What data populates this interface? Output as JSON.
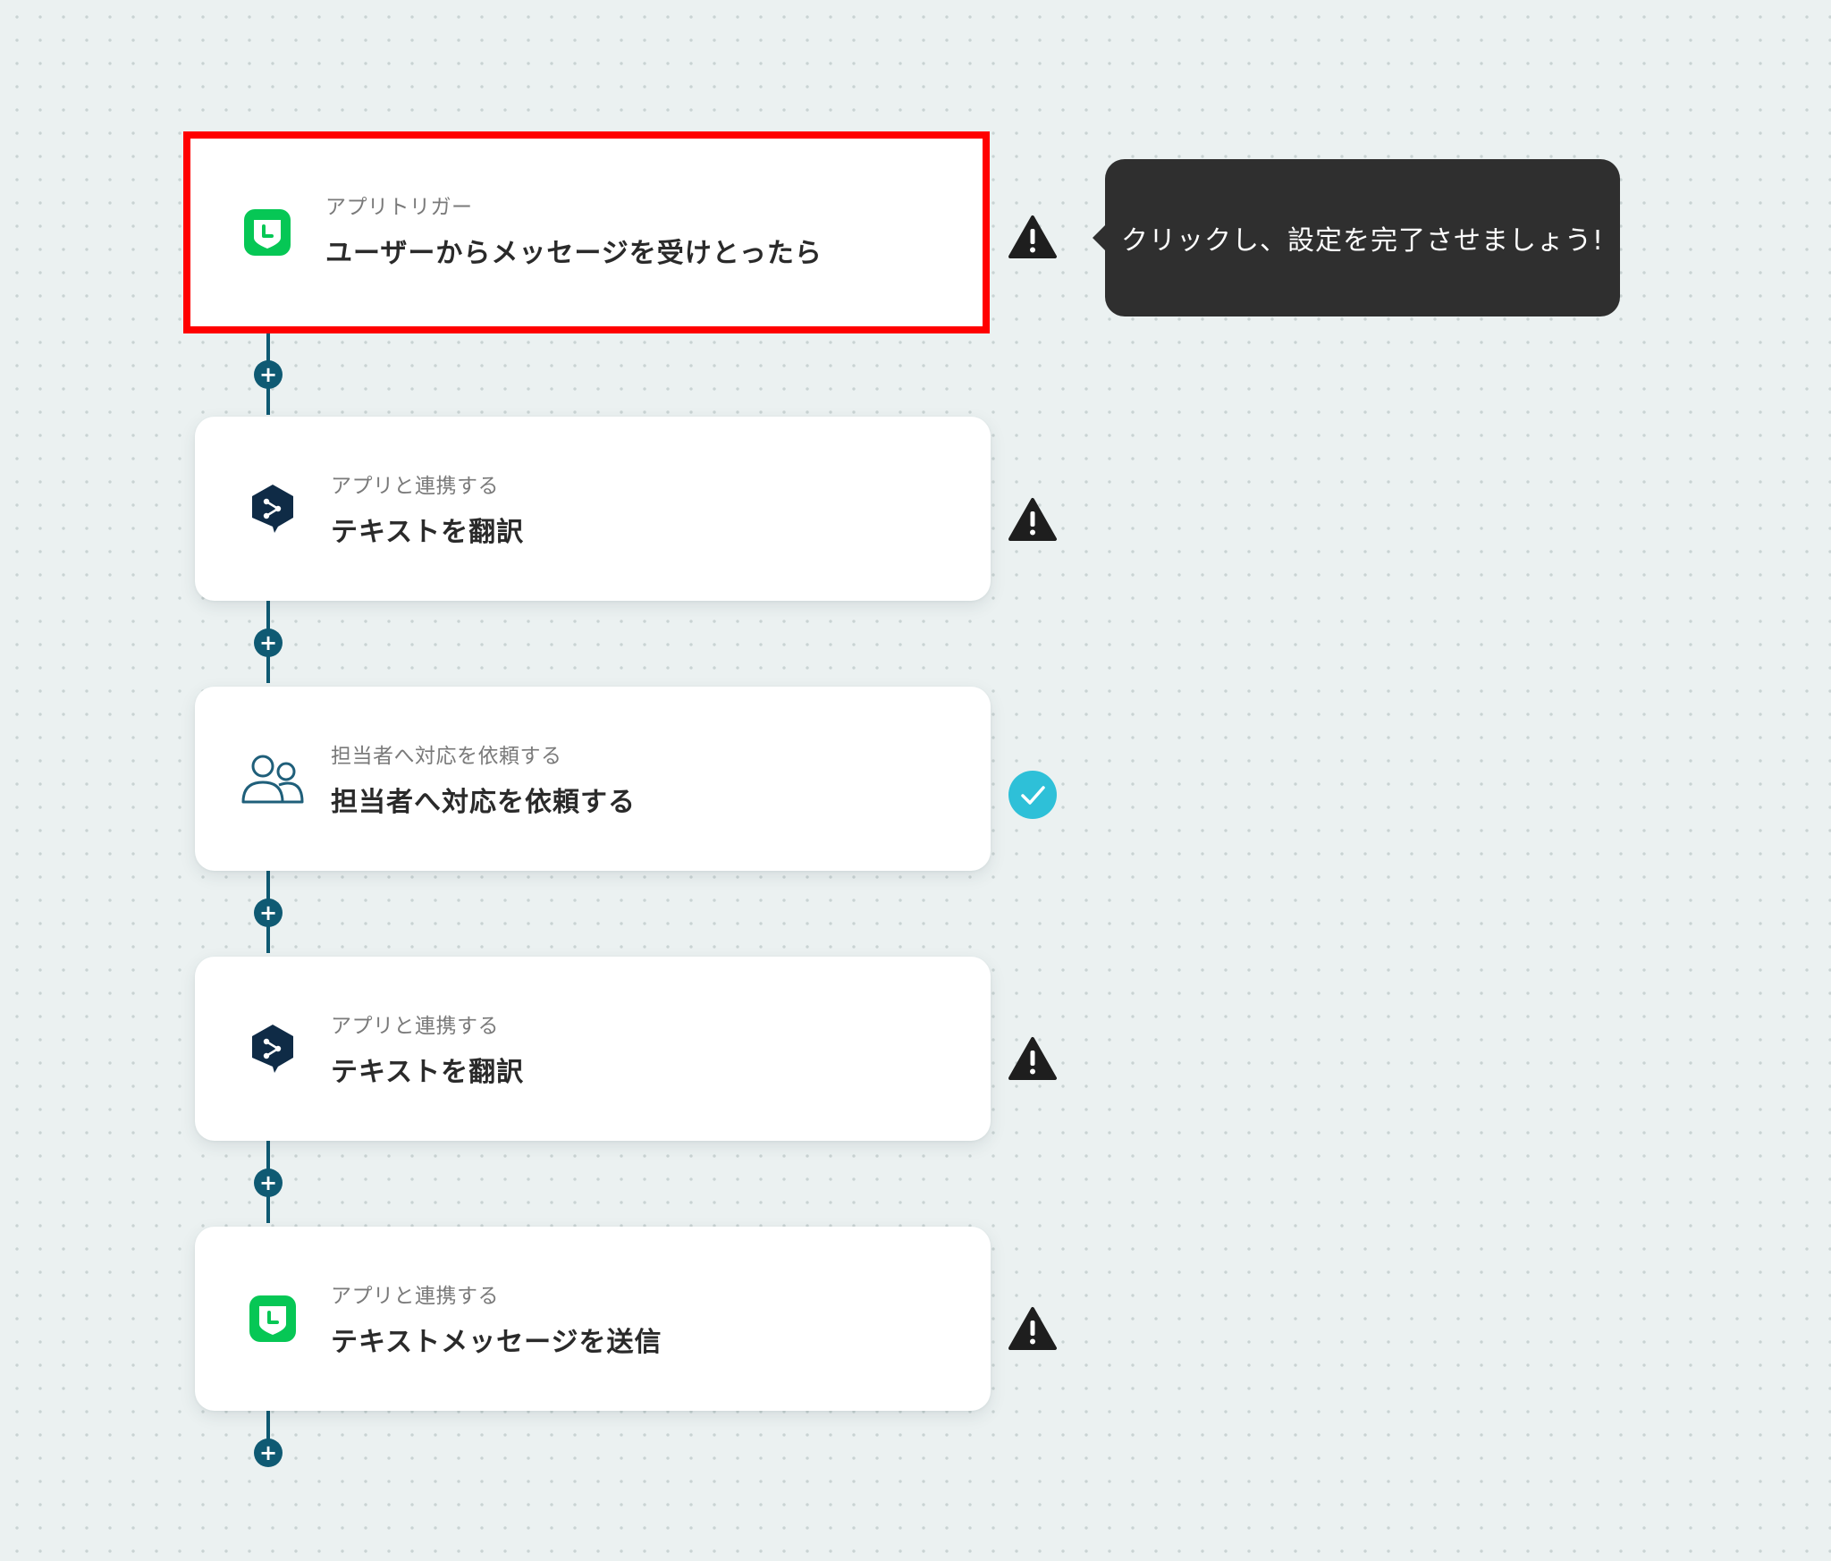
{
  "steps": [
    {
      "category": "アプリトリガー",
      "title": "ユーザーからメッセージを受けとったら",
      "icon": "line-icon",
      "status": "warning",
      "highlighted": true
    },
    {
      "category": "アプリと連携する",
      "title": "テキストを翻訳",
      "icon": "deepl-icon",
      "status": "warning"
    },
    {
      "category": "担当者へ対応を依頼する",
      "title": "担当者へ対応を依頼する",
      "icon": "people-icon",
      "status": "complete"
    },
    {
      "category": "アプリと連携する",
      "title": "テキストを翻訳",
      "icon": "deepl-icon",
      "status": "warning"
    },
    {
      "category": "アプリと連携する",
      "title": "テキストメッセージを送信",
      "icon": "line-icon",
      "status": "warning"
    }
  ],
  "tooltip": {
    "text": "クリックし、設定を完了させましょう!"
  },
  "add_step_symbol": "+",
  "colors": {
    "canvas_bg": "#ebf1f1",
    "connector": "#0f5a73",
    "highlight_border": "#ff0000",
    "line_green": "#06c755",
    "deepl_navy": "#0f2b46",
    "people_icon": "#1f5f7a",
    "complete_cyan": "#2ec0d8",
    "tooltip_bg": "#2f2f2f"
  }
}
